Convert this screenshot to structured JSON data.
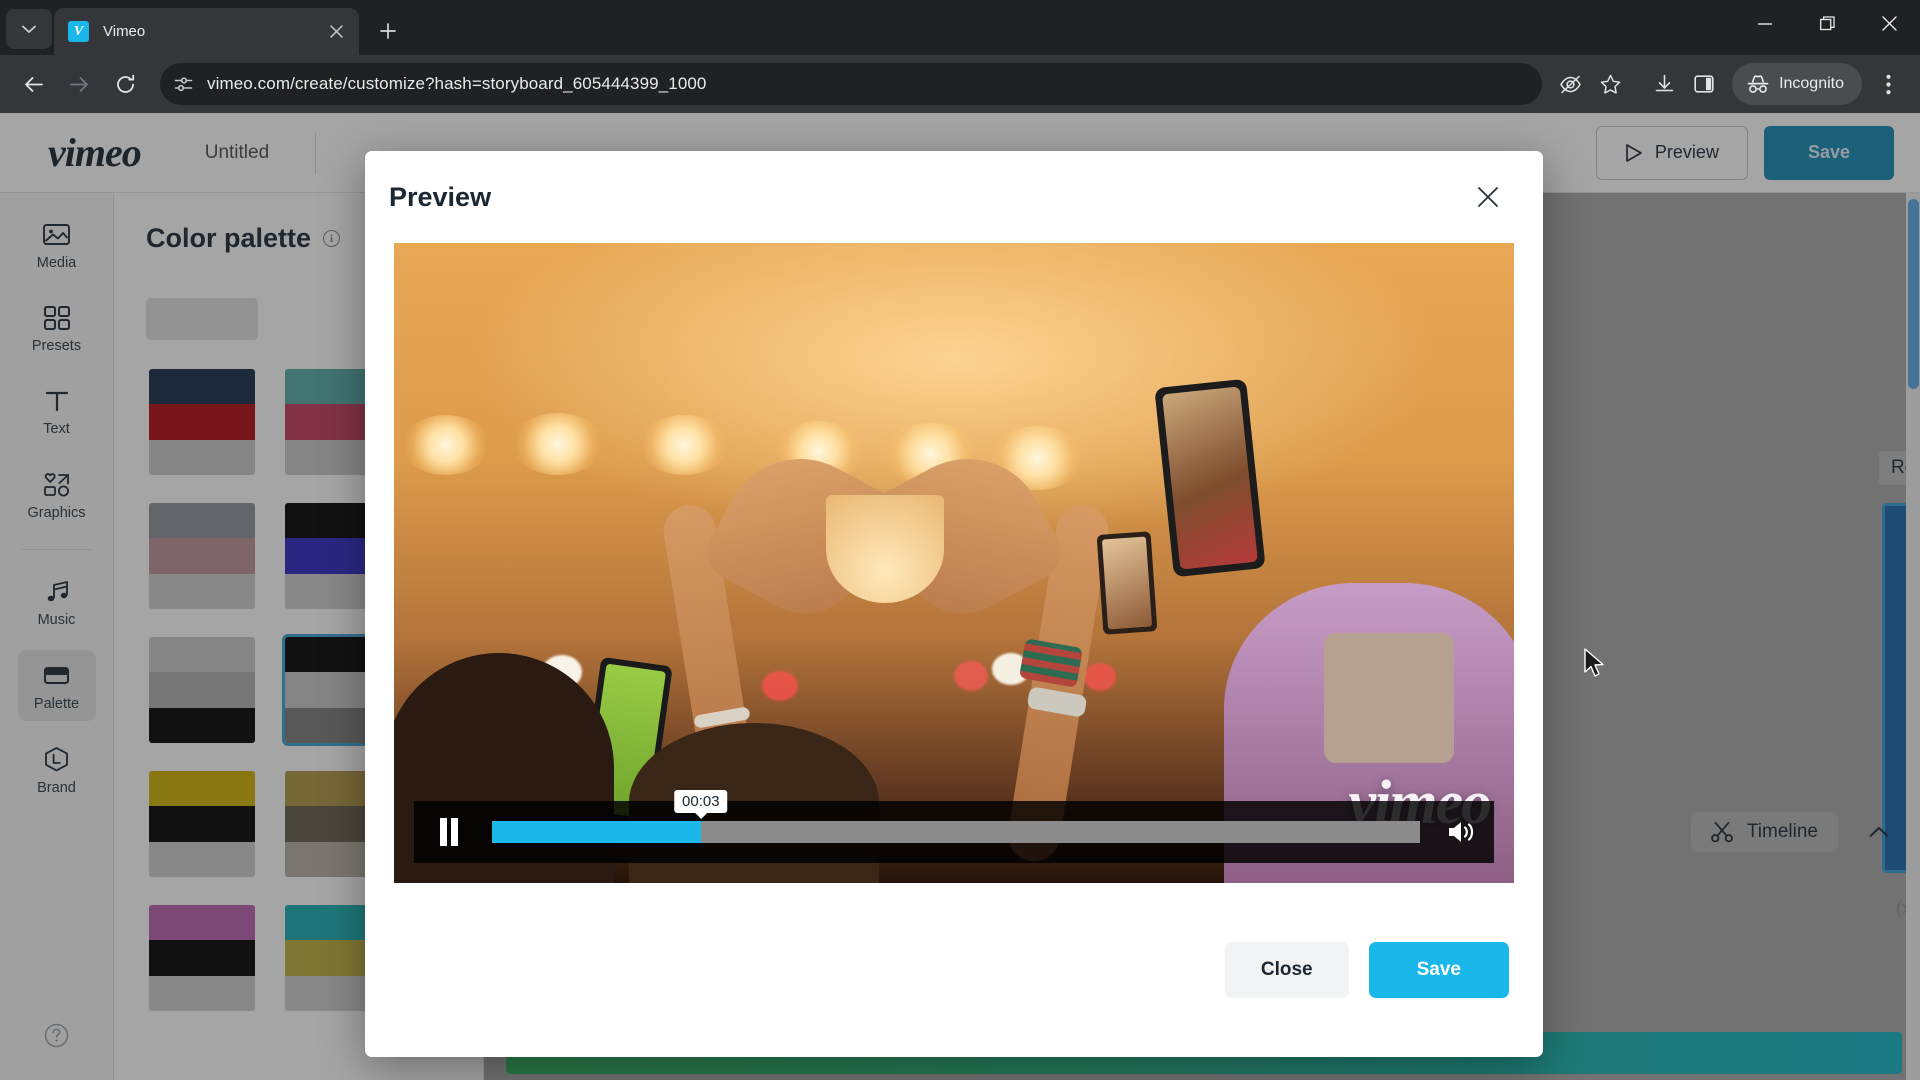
{
  "browser": {
    "tab": {
      "title": "Vimeo",
      "favicon_letter": "V",
      "favicon_icon": "vimeo-favicon"
    },
    "new_tab_label": "+",
    "tab_search_icon": "chevron-down-icon",
    "close_tab_icon": "close-icon",
    "window": {
      "minimize": "minimize-icon",
      "restore": "restore-icon",
      "close": "close-icon"
    },
    "nav": {
      "back": "back-arrow-icon",
      "forward": "forward-arrow-icon",
      "reload": "reload-icon"
    },
    "omnibox": {
      "url": "vimeo.com/create/customize?hash=storyboard_605444399_1000",
      "site_icon": "site-settings-icon"
    },
    "actions": {
      "tracking_icon": "eye-slash-icon",
      "bookmark_icon": "star-icon",
      "download_icon": "download-icon",
      "sidepanel_icon": "side-panel-icon",
      "incognito_label": "Incognito",
      "incognito_icon": "incognito-hat-icon",
      "menu_icon": "kebab-menu-icon"
    }
  },
  "app": {
    "logo": "vimeo",
    "project_title": "Untitled",
    "header_buttons": {
      "preview_label": "Preview",
      "preview_icon": "play-triangle-icon",
      "save_label": "Save"
    },
    "sidebar": {
      "items": [
        {
          "label": "Media",
          "icon": "image-icon",
          "active": false
        },
        {
          "label": "Presets",
          "icon": "grid-icon",
          "active": false
        },
        {
          "label": "Text",
          "icon": "text-t-icon",
          "active": false
        },
        {
          "label": "Graphics",
          "icon": "shapes-icon",
          "active": false
        },
        {
          "label": "Music",
          "icon": "music-note-icon",
          "active": false
        },
        {
          "label": "Palette",
          "icon": "palette-card-icon",
          "active": true
        },
        {
          "label": "Brand",
          "icon": "brand-hex-icon",
          "active": false
        }
      ],
      "help_icon": "help-circle-icon"
    },
    "panel": {
      "title": "Color palette",
      "info_icon": "info-icon",
      "info_glyph": "i",
      "custom_swatch_color": "#e0e0e0",
      "swatches": [
        {
          "colors": [
            "#122a47",
            "#b20a12",
            "#c9c9c9"
          ],
          "selected": false
        },
        {
          "colors": [
            "#52aaa6",
            "#c23a5c",
            "#c9c9c9"
          ],
          "selected": false
        },
        {
          "colors": [
            "#8b9199",
            "#bd929a",
            "#cdcdcd"
          ],
          "selected": false
        },
        {
          "colors": [
            "#000000",
            "#2c27c4",
            "#cdcdcd"
          ],
          "selected": false
        },
        {
          "colors": [
            "#c9c9c9",
            "#b0b0b0",
            "#000000"
          ],
          "selected": false
        },
        {
          "colors": [
            "#000000",
            "#c9c9c9",
            "#7a7a7a"
          ],
          "selected": true
        },
        {
          "colors": [
            "#cfb200",
            "#000000",
            "#cdcdcd"
          ],
          "selected": false
        },
        {
          "colors": [
            "#ae9542",
            "#625c4b",
            "#b5aea2"
          ],
          "selected": false
        },
        {
          "colors": [
            "#b95fae",
            "#000000",
            "#cdcdcd"
          ],
          "selected": false
        },
        {
          "colors": [
            "#17aeb2",
            "#bfae3c",
            "#cdcdcd"
          ],
          "selected": false
        }
      ]
    },
    "canvas": {
      "remove_label": "Remove",
      "clip_count_label": "(x)",
      "timeline_label": "Timeline",
      "timeline_icon": "scissors-icon",
      "collapse_icon": "chevron-up-icon"
    }
  },
  "modal": {
    "title": "Preview",
    "close_icon": "close-icon",
    "player": {
      "state": "playing",
      "pause_icon": "pause-icon",
      "volume_icon": "volume-on-icon",
      "current_time": "00:03",
      "progress_percent": 22.5,
      "watermark": "vimeo"
    },
    "footer": {
      "close_label": "Close",
      "save_label": "Save"
    }
  },
  "colors": {
    "accent_blue": "#1ab7ea",
    "header_save_blue": "#1287b2",
    "canvas_bg": "#a8a8a8",
    "chrome_dark": "#202124",
    "chrome_toolbar": "#35363a",
    "selected_swatch_border": "#3aa3d6"
  }
}
